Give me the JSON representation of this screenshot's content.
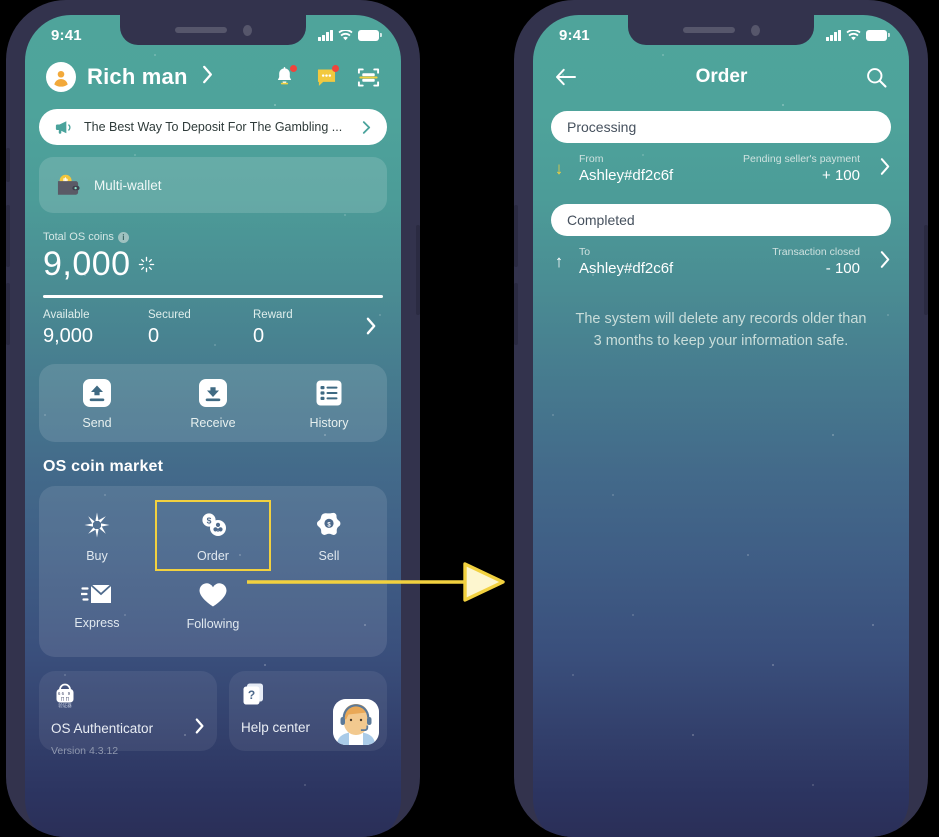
{
  "status_bar": {
    "time": "9:41",
    "signal_icon": "cellular-bars-icon",
    "wifi_icon": "wifi-icon",
    "battery_icon": "battery-icon"
  },
  "home": {
    "user": {
      "name": "Rich man",
      "avatar_icon": "person-avatar-icon",
      "chevron_icon": "chevron-right-icon"
    },
    "header_icons": [
      {
        "name": "notification-bell-icon",
        "label": "Notifications",
        "badge": true
      },
      {
        "name": "message-chat-icon",
        "label": "Messages",
        "badge": true
      },
      {
        "name": "scan-qr-icon",
        "label": "Scan",
        "badge": false
      }
    ],
    "announcement": {
      "icon": "megaphone-icon",
      "text": "The Best Way To Deposit For The Gambling ...",
      "chevron_icon": "chevron-right-icon"
    },
    "wallet_card": {
      "icon": "bitcoin-wallet-icon",
      "label": "Multi-wallet"
    },
    "balance": {
      "label": "Total OS coins",
      "info_icon": "info-icon",
      "amount": "9,000",
      "coin_icon": "os-coin-sparkle-icon",
      "stats": [
        {
          "key": "Available",
          "value": "9,000"
        },
        {
          "key": "Secured",
          "value": "0"
        },
        {
          "key": "Reward",
          "value": "0"
        }
      ],
      "chevron_icon": "chevron-right-icon"
    },
    "actions": [
      {
        "icon": "send-icon",
        "label": "Send"
      },
      {
        "icon": "receive-icon",
        "label": "Receive"
      },
      {
        "icon": "history-list-icon",
        "label": "History"
      }
    ],
    "market_title": "OS coin market",
    "market": [
      {
        "icon": "buy-burst-icon",
        "label": "Buy",
        "selected": false
      },
      {
        "icon": "order-coins-icon",
        "label": "Order",
        "selected": true
      },
      {
        "icon": "sell-coin-icon",
        "label": "Sell",
        "selected": false
      },
      {
        "icon": "express-envelope-icon",
        "label": "Express",
        "selected": false
      },
      {
        "icon": "following-heart-icon",
        "label": "Following",
        "selected": false
      }
    ],
    "authenticator": {
      "icon": "authenticator-lock-icon",
      "label": "OS Authenticator",
      "version": "Version 4.3.12",
      "chevron_icon": "chevron-right-icon"
    },
    "help": {
      "icon": "question-doc-icon",
      "label": "Help center",
      "support_avatar_icon": "support-agent-avatar-icon"
    }
  },
  "order": {
    "back_icon": "back-arrow-icon",
    "title": "Order",
    "search_icon": "search-icon",
    "sections": [
      {
        "pill": "Processing",
        "direction_icon": "arrow-down-icon",
        "direction_color": "#f2d13f",
        "key": "From",
        "party": "Ashley#df2c6f",
        "status": "Pending seller's payment",
        "amount": "+ 100",
        "chevron_icon": "chevron-right-icon"
      },
      {
        "pill": "Completed",
        "direction_icon": "arrow-up-icon",
        "direction_color": "#ffffff",
        "key": "To",
        "party": "Ashley#df2c6f",
        "status": "Transaction closed",
        "amount": "- 100",
        "chevron_icon": "chevron-right-icon"
      }
    ],
    "notice": "The system will delete any records older than 3 months to keep your information safe."
  },
  "connector": {
    "icon": "flow-arrow-icon",
    "color": "#f2d13f"
  },
  "colors": {
    "page_background": "#000000",
    "phone_frame": "#33334d",
    "screen_top": "#4fa49b",
    "screen_bottom": "#2a2e56",
    "accent_yellow": "#f2d13f",
    "badge_red": "#f0443c",
    "white": "#ffffff"
  }
}
